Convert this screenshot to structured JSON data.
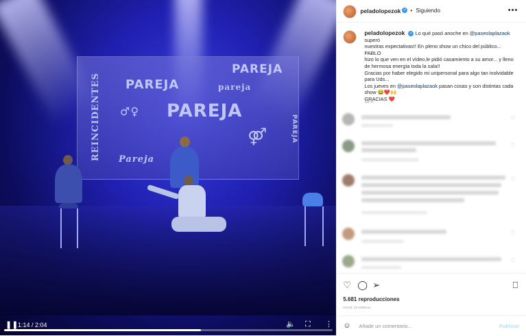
{
  "video": {
    "screen_words": [
      "PAREJA",
      "PAREJA",
      "pareja",
      "PAREJA",
      "Pareja",
      "REINCIDENTES",
      "PAREJA"
    ],
    "time": "1:14 / 2:04",
    "progress": 0.6,
    "icons": {
      "pause": "pause-icon",
      "volume": "volume-icon",
      "fullscreen": "fullscreen-icon",
      "more": "more-vertical-icon"
    }
  },
  "header": {
    "username": "peladolopezok",
    "separator": "•",
    "follow_label": "Siguiendo",
    "more": "•••"
  },
  "caption": {
    "username": "peladolopezok",
    "lines": [
      {
        "pre": "Lo qué pasó anoche en ",
        "mention": "@paseolaplazaok",
        "post": " superó"
      },
      {
        "pre": "nuestras expectativas!! En pleno show un chico del público... PABLO"
      },
      {
        "pre": "hizo lo que ven en el vídeo,le pidió casamiento a su amor... y lleno"
      },
      {
        "pre": "de hermosa energía toda la sala!!"
      },
      {
        "pre": "Gracias por haber elegido mi unipersonal para algo tan inolvidable"
      },
      {
        "pre": "para Uds..."
      },
      {
        "pre": "Los jueves en ",
        "mention": "@paseolaplazaok",
        "post": " pasan cosas y son distintas cada"
      },
      {
        "pre": "show 😂❤️🙌"
      },
      {
        "pre": "GRACIAS ❤️"
      }
    ],
    "time": "19 h"
  },
  "actions": {
    "like": "heart-icon",
    "comment": "comment-icon",
    "share": "share-icon",
    "save": "bookmark-icon"
  },
  "views": "5.681 reproducciones",
  "ago": "HACE 19 HORAS",
  "add_comment": {
    "placeholder": "Añade un comentario...",
    "publish": "Publicar"
  },
  "colors": {
    "link": "#00376b",
    "verified": "#3897f0",
    "publish_disabled": "#b2dffc",
    "stage_blue": "#1f20b0"
  }
}
